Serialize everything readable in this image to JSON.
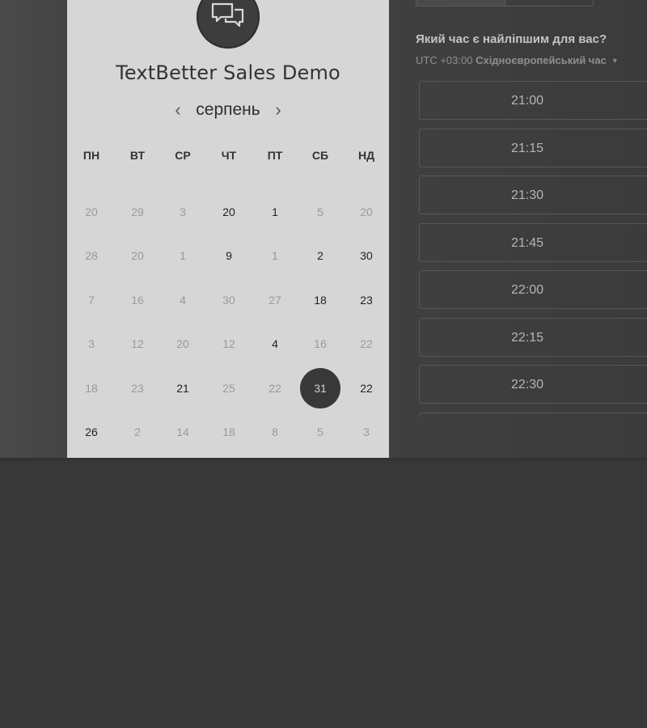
{
  "event": {
    "title": "TextBetter Sales Demo"
  },
  "calendar": {
    "month": "серпень",
    "prev_icon": "‹",
    "next_icon": "›",
    "weekdays": [
      "ПН",
      "ВТ",
      "СР",
      "ЧТ",
      "ПТ",
      "СБ",
      "НД"
    ],
    "weeks": [
      [
        {
          "d": "20",
          "s": "off"
        },
        {
          "d": "29",
          "s": "off"
        },
        {
          "d": "3",
          "s": "off"
        },
        {
          "d": "20",
          "s": "avail"
        },
        {
          "d": "1",
          "s": "avail"
        },
        {
          "d": "5",
          "s": "off"
        },
        {
          "d": "20",
          "s": "off"
        }
      ],
      [
        {
          "d": "28",
          "s": "off"
        },
        {
          "d": "20",
          "s": "off"
        },
        {
          "d": "1",
          "s": "off"
        },
        {
          "d": "9",
          "s": "avail"
        },
        {
          "d": "1",
          "s": "off"
        },
        {
          "d": "2",
          "s": "avail"
        },
        {
          "d": "30",
          "s": "avail"
        }
      ],
      [
        {
          "d": "7",
          "s": "off"
        },
        {
          "d": "16",
          "s": "off"
        },
        {
          "d": "4",
          "s": "off"
        },
        {
          "d": "30",
          "s": "off"
        },
        {
          "d": "27",
          "s": "off"
        },
        {
          "d": "18",
          "s": "avail"
        },
        {
          "d": "23",
          "s": "avail"
        }
      ],
      [
        {
          "d": "3",
          "s": "off"
        },
        {
          "d": "12",
          "s": "off"
        },
        {
          "d": "20",
          "s": "off"
        },
        {
          "d": "12",
          "s": "off"
        },
        {
          "d": "4",
          "s": "avail"
        },
        {
          "d": "16",
          "s": "off"
        },
        {
          "d": "22",
          "s": "off"
        }
      ],
      [
        {
          "d": "18",
          "s": "off"
        },
        {
          "d": "23",
          "s": "off"
        },
        {
          "d": "21",
          "s": "avail"
        },
        {
          "d": "25",
          "s": "off"
        },
        {
          "d": "22",
          "s": "off"
        },
        {
          "d": "31",
          "s": "sel"
        },
        {
          "d": "22",
          "s": "avail"
        }
      ],
      [
        {
          "d": "26",
          "s": "avail"
        },
        {
          "d": "2",
          "s": "off"
        },
        {
          "d": "14",
          "s": "off"
        },
        {
          "d": "18",
          "s": "off"
        },
        {
          "d": "8",
          "s": "off"
        },
        {
          "d": "5",
          "s": "off"
        },
        {
          "d": "3",
          "s": "off"
        }
      ]
    ]
  },
  "times": {
    "question": "Який час є найліпшим для вас?",
    "timezone_offset": "UTC +03:00",
    "timezone_name": "Східноєвропейський час",
    "slots": [
      "21:00",
      "21:15",
      "21:30",
      "21:45",
      "22:00",
      "22:15",
      "22:30",
      ""
    ]
  },
  "colors": {
    "selected_day": "#383838",
    "card_bg": "#d6d6d6",
    "page_bg": "#383838"
  }
}
